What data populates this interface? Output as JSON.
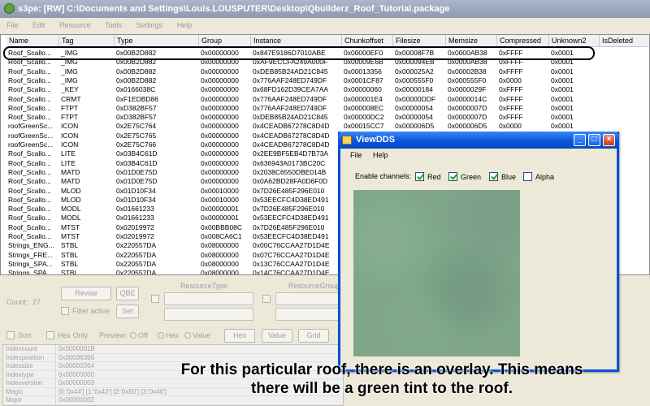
{
  "window": {
    "title": "s3pe: [RW] C:\\Documents and Settings\\Louis.LOUSPUTER\\Desktop\\Qbuilderz_Roof_Tutorial.package"
  },
  "menu": [
    "File",
    "Edit",
    "Resource",
    "Tools",
    "Settings",
    "Help"
  ],
  "grid": {
    "columns": [
      "Name",
      "Tag",
      "Type",
      "Group",
      "Instance",
      "Chunkoffset",
      "Filesize",
      "Memsize",
      "Compressed",
      "Unknown2",
      "IsDeleted"
    ],
    "rows": [
      [
        "Roof_Scallo...",
        "_IMG",
        "0x00B2D882",
        "0x00000000",
        "0x847E9186D7010ABE",
        "0x00000EF0",
        "0x00008F7B",
        "0x0000AB38",
        "0xFFFF",
        "0x0001"
      ],
      [
        "Roof_Scallo...",
        "_IMG",
        "0x00B2D882",
        "0x00000000",
        "0xAF9ECCFA249A000F",
        "0x00009E6B",
        "0x000094EB",
        "0x0000AB38",
        "0xFFFF",
        "0x0001"
      ],
      [
        "Roof_Scallo...",
        "_IMG",
        "0x00B2D882",
        "0x00000000",
        "0xDEB85B24AD21C845",
        "0x00013356",
        "0x000025A2",
        "0x00002B38",
        "0xFFFF",
        "0x0001"
      ],
      [
        "Roof_Scallo...",
        "_IMG",
        "0x00B2D882",
        "0x00000000",
        "0x776AAF248ED749DF",
        "0x0001CF87",
        "0x000555F0",
        "0x000555F0",
        "0x0000",
        "0x0001"
      ],
      [
        "Roof_Scallo...",
        "_KEY",
        "0x0166038C",
        "0x00000000",
        "0x68FD162D39CEA7AA",
        "0x00000060",
        "0x00000184",
        "0x0000029F",
        "0xFFFF",
        "0x0001"
      ],
      [
        "Roof_Scallo...",
        "CRMT",
        "0xF1EDBD86",
        "0x00000000",
        "0x776AAF248ED749DF",
        "0x000001E4",
        "0x00000DDF",
        "0x0000014C",
        "0xFFFF",
        "0x0001"
      ],
      [
        "Roof_Scallo...",
        "FTPT",
        "0xD382BF57",
        "0x00000000",
        "0x776AAF248ED749DF",
        "0x000008EC",
        "0x00000054",
        "0x0000007D",
        "0xFFFF",
        "0x0001"
      ],
      [
        "Roof_Scallo...",
        "FTPT",
        "0xD382BF57",
        "0x00000000",
        "0xDEB85B24AD21C845",
        "0x00000DC2",
        "0x00000054",
        "0x0000007D",
        "0xFFFF",
        "0x0001"
      ],
      [
        "roofGreenSc...",
        "ICON",
        "0x2E75C764",
        "0x00000000",
        "0x4CEADB67278C8D4D",
        "0x00015CC7",
        "0x000006D5",
        "0x000006D5",
        "0x0000",
        "0x0001"
      ],
      [
        "roofGreenSc...",
        "ICON",
        "0x2E75C765",
        "0x00000000",
        "0x4CEADB67278C8D4D",
        "",
        "",
        "",
        "",
        ""
      ],
      [
        "roofGreenSc...",
        "ICON",
        "0x2E75C766",
        "0x00000000",
        "0x4CEADB67278C8D4D",
        "",
        "",
        "",
        "",
        ""
      ],
      [
        "Roof_Scallo...",
        "LITE",
        "0x03B4C61D",
        "0x00000000",
        "0x2EE9BF5EB4D7B73A",
        "",
        "",
        "",
        "",
        ""
      ],
      [
        "Roof_Scallo...",
        "LITE",
        "0x03B4C61D",
        "0x00000000",
        "0x636943A0173BC20C",
        "",
        "",
        "",
        "",
        ""
      ],
      [
        "Roof_Scallo...",
        "MATD",
        "0x01D0E75D",
        "0x00000000",
        "0x2038C6550DBE014B",
        "",
        "",
        "",
        "",
        ""
      ],
      [
        "Roof_Scallo...",
        "MATD",
        "0x01D0E75D",
        "0x00000000",
        "0x0A62BD28FA0D6F0D",
        "",
        "",
        "",
        "",
        ""
      ],
      [
        "Roof_Scallo...",
        "MLOD",
        "0x01D10F34",
        "0x00010000",
        "0x7D26E485F296E010",
        "",
        "",
        "",
        "",
        ""
      ],
      [
        "Roof_Scallo...",
        "MLOD",
        "0x01D10F34",
        "0x00010000",
        "0x53EECFC4D38ED491",
        "",
        "",
        "",
        "",
        ""
      ],
      [
        "Roof_Scallo...",
        "MODL",
        "0x01661233",
        "0x00000001",
        "0x7D26E485F296E010",
        "",
        "",
        "",
        "",
        ""
      ],
      [
        "Roof_Scallo...",
        "MODL",
        "0x01661233",
        "0x00000001",
        "0x53EECFC4D38ED491",
        "",
        "",
        "",
        "",
        ""
      ],
      [
        "Roof_Scallo...",
        "MTST",
        "0x02019972",
        "0x00BBB08C",
        "0x7D26E485F296E010",
        "",
        "",
        "",
        "",
        ""
      ],
      [
        "Roof_Scallo...",
        "MTST",
        "0x02019972",
        "0x008CA6C1",
        "0x53EECFC4D38ED491",
        "",
        "",
        "",
        "",
        ""
      ],
      [
        "Strings_ENG...",
        "STBL",
        "0x220557DA",
        "0x08000000",
        "0x00C76CCAA27D1D4E",
        "",
        "",
        "",
        "",
        ""
      ],
      [
        "Strings_FRE...",
        "STBL",
        "0x220557DA",
        "0x08000000",
        "0x07C76CCAA27D1D4E",
        "",
        "",
        "",
        "",
        ""
      ],
      [
        "Strings_SPA...",
        "STBL",
        "0x220557DA",
        "0x08000000",
        "0x13C76CCAA27D1D4E",
        "",
        "",
        "",
        "",
        ""
      ],
      [
        "Strings_SPA...",
        "STBL",
        "0x220557DA",
        "0x08000000",
        "0x14C76CCAA27D1D4E",
        "",
        "",
        "",
        "",
        ""
      ]
    ]
  },
  "lower": {
    "count_label": "Count:",
    "count_value": "27",
    "revise_label": "Revise",
    "qbe_label": "QBE",
    "filter_active_label": "Filter active",
    "set_label": "Set",
    "resource_type_label": "ResourceType",
    "resource_group_label": "ResourceGroup",
    "sort_label": "Sort",
    "hex_only_label": "Hex Only",
    "preview_label": "Preview:",
    "preview_options": [
      "Off",
      "Hex",
      "Value"
    ],
    "hex_button": "Hex",
    "value_button": "Value",
    "grid_button": "Grid"
  },
  "properties": [
    {
      "key": "Indexcount",
      "value": "0x0000001B"
    },
    {
      "key": "Indexposition",
      "value": "0x00036366"
    },
    {
      "key": "Indexsize",
      "value": "0x00000364"
    },
    {
      "key": "Indextype",
      "value": "0x00000000"
    },
    {
      "key": "Indexversion",
      "value": "0x00000003"
    },
    {
      "key": "Magic",
      "value": "[0:'0x44'] [1:'0x42'] [2:'0x50'] [3:'0x46']"
    },
    {
      "key": "Major",
      "value": "0x00000002"
    }
  ],
  "viewdds": {
    "title": "ViewDDS",
    "menu": [
      "File",
      "Help"
    ],
    "channels_label": "Enable channels:",
    "channels": [
      {
        "label": "Red",
        "checked": true
      },
      {
        "label": "Green",
        "checked": true
      },
      {
        "label": "Blue",
        "checked": true
      },
      {
        "label": "Alpha",
        "checked": false
      }
    ],
    "texture_color": "#7fa68b"
  },
  "caption": {
    "line1": "For this particular roof, there is an overlay. This means",
    "line2": "there will be a green tint to the roof."
  },
  "colors": {
    "highlight_ring": "#000000",
    "dds_titlebar": "#0a55d8"
  }
}
